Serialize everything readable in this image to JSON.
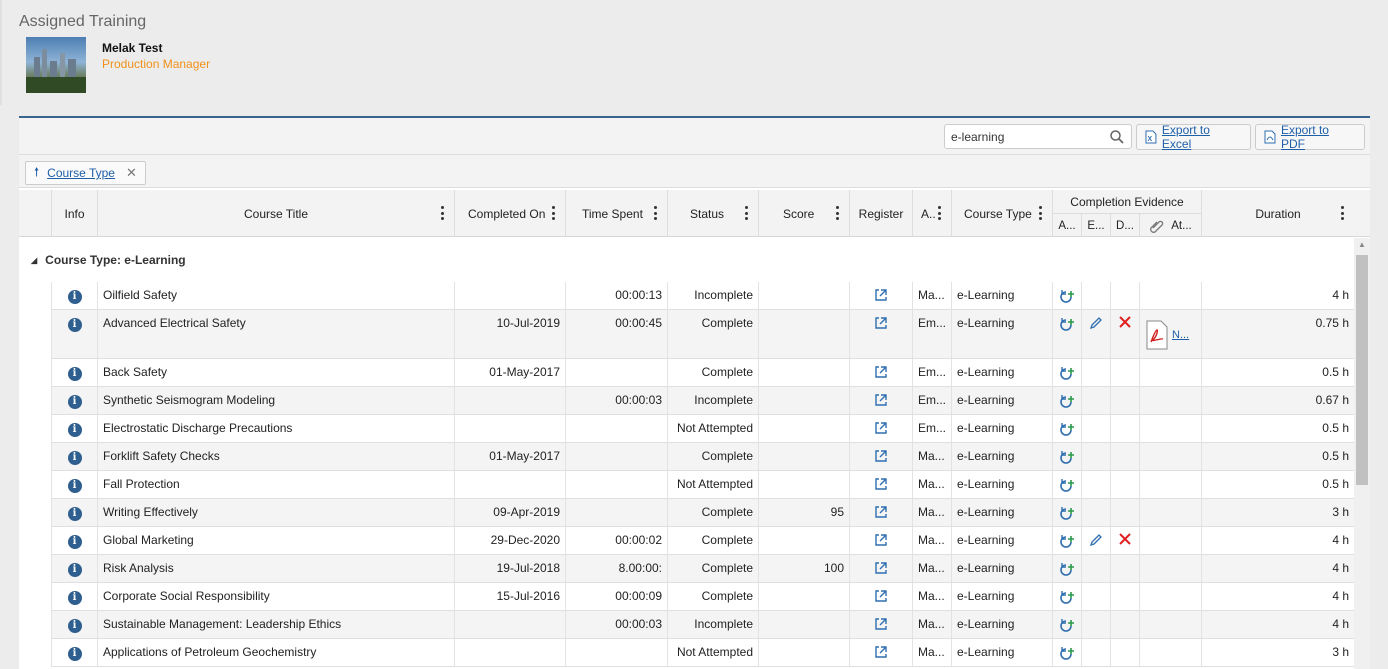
{
  "page": {
    "title": "Assigned Training"
  },
  "user": {
    "name": "Melak Test",
    "role": "Production Manager"
  },
  "toolbar": {
    "search_value": "e-learning",
    "export_excel": "Export to Excel",
    "export_pdf": "Export to PDF"
  },
  "grouping": {
    "chip_label": "Course Type"
  },
  "columns": {
    "info": "Info",
    "title": "Course Title",
    "completed_on": "Completed On",
    "time_spent": "Time Spent",
    "status": "Status",
    "score": "Score",
    "register": "Register",
    "a": "A..",
    "course_type": "Course Type",
    "evidence_group": "Completion Evidence",
    "ev_a": "A...",
    "ev_e": "E...",
    "ev_d": "D...",
    "ev_at": "At...",
    "duration": "Duration"
  },
  "group": {
    "label": "Course Type: e-Learning"
  },
  "rows": [
    {
      "title": "Oilfield Safety",
      "completed_on": "",
      "time_spent": "00:00:13",
      "status": "Incomplete",
      "score": "",
      "a": "Ma...",
      "course_type": "e-Learning",
      "edit": false,
      "delete": false,
      "attachment": "",
      "duration": "4 h"
    },
    {
      "title": "Advanced Electrical Safety",
      "completed_on": "10-Jul-2019",
      "time_spent": "00:00:45",
      "status": "Complete",
      "score": "",
      "a": "Em...",
      "course_type": "e-Learning",
      "edit": true,
      "delete": true,
      "attachment": "N...",
      "duration": "0.75 h"
    },
    {
      "title": "Back Safety",
      "completed_on": "01-May-2017",
      "time_spent": "",
      "status": "Complete",
      "score": "",
      "a": "Em...",
      "course_type": "e-Learning",
      "edit": false,
      "delete": false,
      "attachment": "",
      "duration": "0.5 h"
    },
    {
      "title": "Synthetic Seismogram Modeling",
      "completed_on": "",
      "time_spent": "00:00:03",
      "status": "Incomplete",
      "score": "",
      "a": "Em...",
      "course_type": "e-Learning",
      "edit": false,
      "delete": false,
      "attachment": "",
      "duration": "0.67 h"
    },
    {
      "title": "Electrostatic Discharge Precautions",
      "completed_on": "",
      "time_spent": "",
      "status": "Not Attempted",
      "score": "",
      "a": "Em...",
      "course_type": "e-Learning",
      "edit": false,
      "delete": false,
      "attachment": "",
      "duration": "0.5 h"
    },
    {
      "title": "Forklift Safety Checks",
      "completed_on": "01-May-2017",
      "time_spent": "",
      "status": "Complete",
      "score": "",
      "a": "Ma...",
      "course_type": "e-Learning",
      "edit": false,
      "delete": false,
      "attachment": "",
      "duration": "0.5 h"
    },
    {
      "title": "Fall Protection",
      "completed_on": "",
      "time_spent": "",
      "status": "Not Attempted",
      "score": "",
      "a": "Ma...",
      "course_type": "e-Learning",
      "edit": false,
      "delete": false,
      "attachment": "",
      "duration": "0.5 h"
    },
    {
      "title": "Writing Effectively",
      "completed_on": "09-Apr-2019",
      "time_spent": "",
      "status": "Complete",
      "score": "95",
      "a": "Ma...",
      "course_type": "e-Learning",
      "edit": false,
      "delete": false,
      "attachment": "",
      "duration": "3 h"
    },
    {
      "title": "Global Marketing",
      "completed_on": "29-Dec-2020",
      "time_spent": "00:00:02",
      "status": "Complete",
      "score": "",
      "a": "Ma...",
      "course_type": "e-Learning",
      "edit": true,
      "delete": true,
      "attachment": "",
      "duration": "4 h"
    },
    {
      "title": "Risk Analysis",
      "completed_on": "19-Jul-2018",
      "time_spent": "8.00:00:",
      "status": "Complete",
      "score": "100",
      "a": "Ma...",
      "course_type": "e-Learning",
      "edit": false,
      "delete": false,
      "attachment": "",
      "duration": "4 h"
    },
    {
      "title": "Corporate Social Responsibility",
      "completed_on": "15-Jul-2016",
      "time_spent": "00:00:09",
      "status": "Complete",
      "score": "",
      "a": "Ma...",
      "course_type": "e-Learning",
      "edit": false,
      "delete": false,
      "attachment": "",
      "duration": "4 h"
    },
    {
      "title": "Sustainable Management: Leadership Ethics",
      "completed_on": "",
      "time_spent": "00:00:03",
      "status": "Incomplete",
      "score": "",
      "a": "Ma...",
      "course_type": "e-Learning",
      "edit": false,
      "delete": false,
      "attachment": "",
      "duration": "4 h"
    },
    {
      "title": "Applications of Petroleum Geochemistry",
      "completed_on": "",
      "time_spent": "",
      "status": "Not Attempted",
      "score": "",
      "a": "Ma...",
      "course_type": "e-Learning",
      "edit": false,
      "delete": false,
      "attachment": "",
      "duration": "3 h"
    }
  ],
  "colors": {
    "accent": "#1f5fa8",
    "role": "#f0901a",
    "info_icon": "#2e5f8f",
    "delete": "#e02020"
  }
}
